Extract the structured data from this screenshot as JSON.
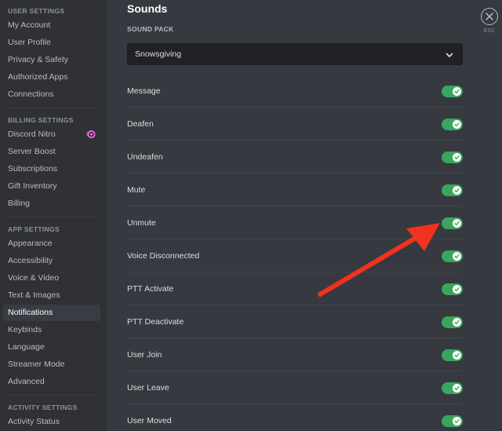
{
  "sidebar": {
    "sections": [
      {
        "header": "USER SETTINGS",
        "items": [
          "My Account",
          "User Profile",
          "Privacy & Safety",
          "Authorized Apps",
          "Connections"
        ]
      },
      {
        "header": "BILLING SETTINGS",
        "items": [
          "Discord Nitro",
          "Server Boost",
          "Subscriptions",
          "Gift Inventory",
          "Billing"
        ]
      },
      {
        "header": "APP SETTINGS",
        "items": [
          "Appearance",
          "Accessibility",
          "Voice & Video",
          "Text & Images",
          "Notifications",
          "Keybinds",
          "Language",
          "Streamer Mode",
          "Advanced"
        ]
      },
      {
        "header": "ACTIVITY SETTINGS",
        "items": [
          "Activity Status"
        ]
      }
    ],
    "active_item": "Notifications",
    "nitro_icon_color": "#ff73fa"
  },
  "main": {
    "title": "Sounds",
    "sound_pack": {
      "label": "SOUND PACK",
      "value": "Snowsgiving"
    },
    "sounds": [
      {
        "label": "Message",
        "enabled": true
      },
      {
        "label": "Deafen",
        "enabled": true
      },
      {
        "label": "Undeafen",
        "enabled": true
      },
      {
        "label": "Mute",
        "enabled": true
      },
      {
        "label": "Unmute",
        "enabled": true
      },
      {
        "label": "Voice Disconnected",
        "enabled": true
      },
      {
        "label": "PTT Activate",
        "enabled": true
      },
      {
        "label": "PTT Deactivate",
        "enabled": true
      },
      {
        "label": "User Join",
        "enabled": true
      },
      {
        "label": "User Leave",
        "enabled": true
      },
      {
        "label": "User Moved",
        "enabled": true
      }
    ]
  },
  "close": {
    "label": "ESC"
  },
  "colors": {
    "toggle_on": "#3ba55c",
    "arrow": "#f0321e",
    "background": "#36393f",
    "sidebar": "#2f3136"
  }
}
